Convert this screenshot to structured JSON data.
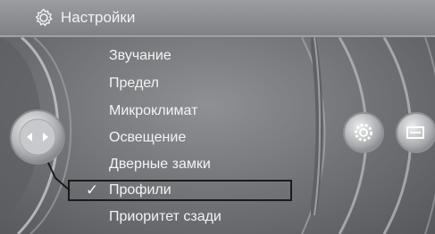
{
  "header": {
    "title": "Настройки",
    "icon": "gear-icon"
  },
  "menu": {
    "items": [
      {
        "label": "Звучание"
      },
      {
        "label": "Предел"
      },
      {
        "label": "Микроклимат"
      },
      {
        "label": "Освещение"
      },
      {
        "label": "Дверные замки"
      },
      {
        "label": "Профили",
        "selected": true
      },
      {
        "label": "Приоритет сзади"
      }
    ],
    "selected_mark": "✓"
  },
  "controller": {
    "icon": "controller-arrows-icon"
  },
  "side_buttons": [
    {
      "icon": "gear-icon"
    },
    {
      "icon": "display-card-icon"
    }
  ],
  "colors": {
    "background": "#74767a",
    "text": "#f4f4f4",
    "selection_border": "#1a1a1a"
  }
}
